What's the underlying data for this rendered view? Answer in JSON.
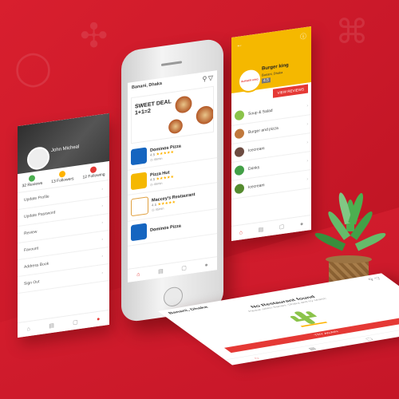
{
  "profile": {
    "user_name": "John Micheal",
    "stats": [
      {
        "value": "32",
        "label": "Reviews",
        "color": "#4caf50"
      },
      {
        "value": "13",
        "label": "Followers",
        "color": "#ffb300"
      },
      {
        "value": "12",
        "label": "Following",
        "color": "#e53935"
      }
    ],
    "menu": [
      "Update Profile",
      "Update Password",
      "Review",
      "Favourit",
      "Address Book",
      "Sign Out"
    ]
  },
  "phone": {
    "location": "Banani, Dhaka",
    "banner_line1": "SWEET DEAL",
    "banner_line2": "1+1=2",
    "restaurants": [
      {
        "name": "Dominos Pizza",
        "rating": "4.5",
        "stars": "★★★★★",
        "time": "45min",
        "logo_color": "#1565c0"
      },
      {
        "name": "Pizza Hut",
        "rating": "4.5",
        "stars": "★★★★★",
        "time": "45min",
        "logo_color": "#f5b800"
      },
      {
        "name": "Maccey's Restaurant",
        "rating": "4.5",
        "stars": "★★★★★",
        "time": "45min",
        "logo_color": "#e0a040"
      },
      {
        "name": "Dominos Pizza",
        "rating": "",
        "stars": "",
        "time": "",
        "logo_color": "#1565c0"
      }
    ]
  },
  "menu_screen": {
    "restaurant": "Burger king",
    "logo_text": "BURGER KING",
    "subtitle": "Banani, Dhaka",
    "rating": "4.5",
    "view_button": "VIEW REVIEWS",
    "categories": [
      {
        "name": "Soup & Salad",
        "color": "#8bc34a"
      },
      {
        "name": "Burger and pizza",
        "color": "#c0783c"
      },
      {
        "name": "Icecream",
        "color": "#6d4c41"
      },
      {
        "name": "Drinks",
        "color": "#43a047"
      },
      {
        "name": "Icecream",
        "color": "#558b2f"
      }
    ]
  },
  "empty_screen": {
    "location": "Banani, Dhaka",
    "title": "No Restaurant found",
    "subtitle": "Please select Banani, Dhaka and try search",
    "button": "TRY AGAIN"
  }
}
